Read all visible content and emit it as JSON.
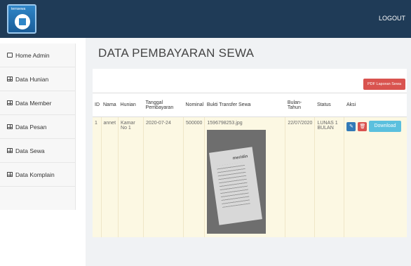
{
  "header": {
    "logo_text": "ternsewa",
    "logout": "LOGOUT"
  },
  "sidebar": {
    "items": [
      {
        "label": "Home Admin",
        "icon": "monitor-icon"
      },
      {
        "label": "Data Hunian",
        "icon": "table-icon"
      },
      {
        "label": "Data Member",
        "icon": "table-icon"
      },
      {
        "label": "Data Pesan",
        "icon": "table-icon"
      },
      {
        "label": "Data Sewa",
        "icon": "table-icon"
      },
      {
        "label": "Data Komplain",
        "icon": "table-icon"
      }
    ]
  },
  "main": {
    "title": "DATA PEMBAYARAN SEWA",
    "pdf_button": "PDF Laporan Sewa",
    "table": {
      "headers": [
        "ID",
        "Nama",
        "Hunian",
        "Tanggal Pembayaran",
        "Nominal",
        "Bukti Transfer Sewa",
        "Bulan-Tahun",
        "Status",
        "Aksi"
      ],
      "rows": [
        {
          "id": "1",
          "nama": "annet",
          "hunian": "Kamar No 1",
          "tanggal": "2020-07-24",
          "nominal": "500000",
          "bukti": "1596798253.jpg",
          "bulan_tahun": "22/07/2020",
          "status": "LUNAS 1 BULAN",
          "receipt_brand": "meridin",
          "edit": "✎",
          "delete": "🗑",
          "download": "Download"
        }
      ]
    }
  },
  "colors": {
    "topbar": "#1f3b57",
    "pdf": "#d9534f",
    "edit": "#337ab7",
    "download": "#5bc0de",
    "row": "#fcf8e3"
  }
}
